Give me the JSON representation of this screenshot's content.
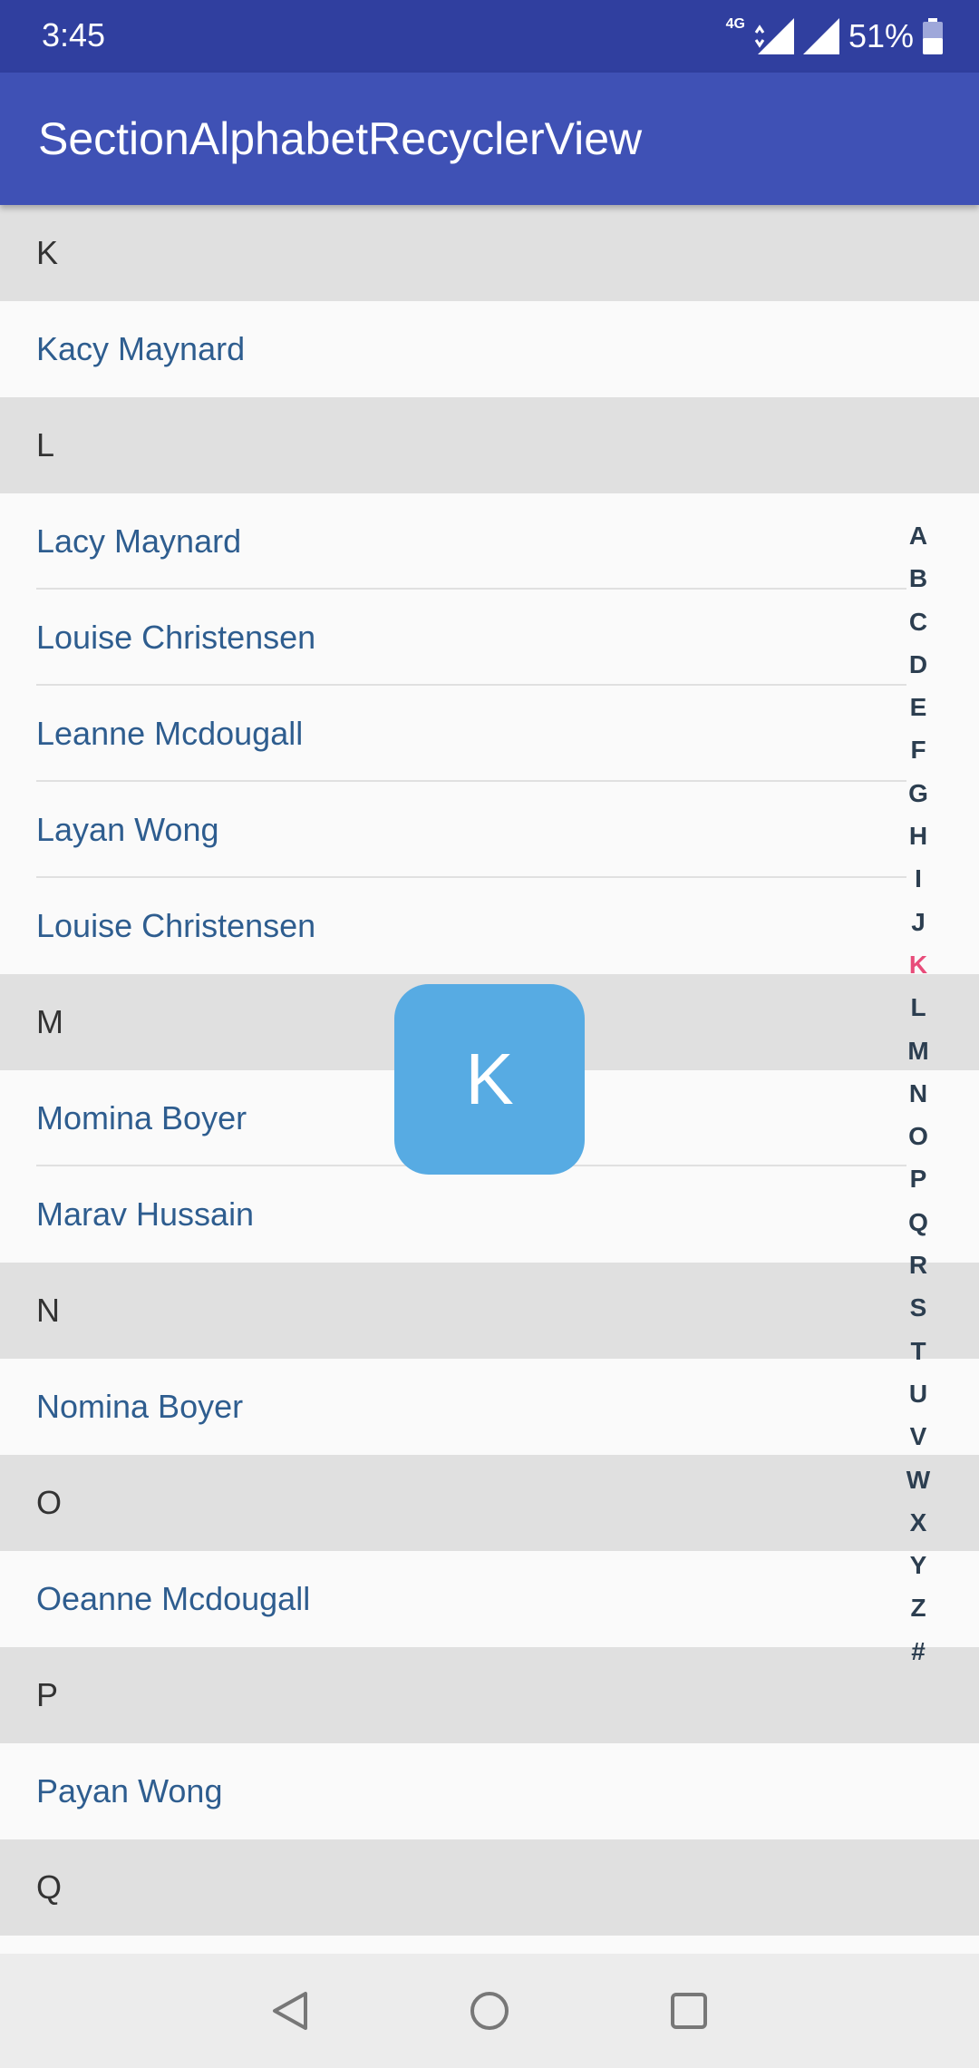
{
  "status_bar": {
    "time": "3:45",
    "network": "4G",
    "battery": "51%"
  },
  "app_bar": {
    "title": "SectionAlphabetRecyclerView"
  },
  "list": {
    "sections": [
      {
        "letter": "K",
        "items": [
          "Kacy Maynard"
        ]
      },
      {
        "letter": "L",
        "items": [
          "Lacy Maynard",
          "Louise Christensen",
          "Leanne Mcdougall",
          "Layan Wong",
          "Louise Christensen"
        ]
      },
      {
        "letter": "M",
        "items": [
          "Momina Boyer",
          "Marav Hussain"
        ]
      },
      {
        "letter": "N",
        "items": [
          "Nomina Boyer"
        ]
      },
      {
        "letter": "O",
        "items": [
          "Oeanne Mcdougall"
        ]
      },
      {
        "letter": "P",
        "items": [
          "Payan Wong"
        ]
      },
      {
        "letter": "Q",
        "items": []
      }
    ]
  },
  "index_bar": {
    "letters": [
      "A",
      "B",
      "C",
      "D",
      "E",
      "F",
      "G",
      "H",
      "I",
      "J",
      "K",
      "L",
      "M",
      "N",
      "O",
      "P",
      "Q",
      "R",
      "S",
      "T",
      "U",
      "V",
      "W",
      "X",
      "Y",
      "Z",
      "#"
    ],
    "selected": "K"
  },
  "bubble": {
    "letter": "K"
  },
  "nav_bar": {
    "icons": [
      "back-icon",
      "home-icon",
      "recents-icon"
    ]
  },
  "colors": {
    "status_bar": "#303f9f",
    "app_bar": "#3f51b5",
    "item_text": "#2e5d8f",
    "index_active": "#e84c7a",
    "bubble": "#57abe3"
  }
}
